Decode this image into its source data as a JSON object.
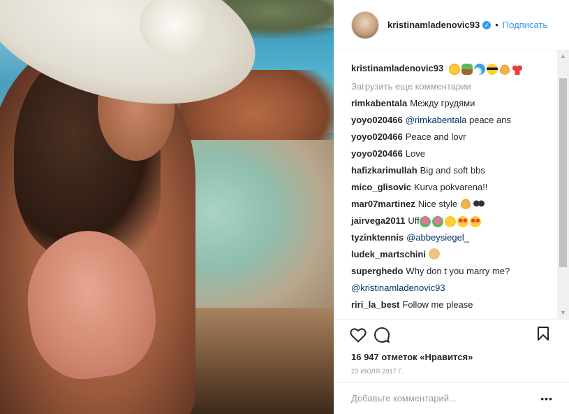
{
  "post": {
    "author": "kristinamladenovic93",
    "follow_label": "Подписать",
    "separator": "•"
  },
  "caption": {
    "user": "kristinamladenovic93",
    "emojis": [
      "sun-emoji",
      "palm-tree-emoji",
      "wave-emoji",
      "sunglasses-face-emoji",
      "sun-hat-emoji",
      "bikini-emoji"
    ]
  },
  "load_more": "Загрузить еще комментарии",
  "comments": [
    {
      "user": "rimkabentala",
      "text": "Между грудями"
    },
    {
      "user": "yoyo020466",
      "mention": "@rimkabentala",
      "text": "peace ans"
    },
    {
      "user": "yoyo020466",
      "text": "Peace and lovr"
    },
    {
      "user": "yoyo020466",
      "text": "Love"
    },
    {
      "user": "hafizkarimullah",
      "text": "Big and soft bbs"
    },
    {
      "user": "mico_glisovic",
      "text": "Kurva pokvarena!!"
    },
    {
      "user": "mar07martinez",
      "text": "Nice style"
    },
    {
      "user": "jairvega2011",
      "text": "Uff"
    },
    {
      "user": "tyzinktennis",
      "mention": "@abbeysiegel_",
      "text": ""
    },
    {
      "user": "ludek_martschini",
      "text": ""
    },
    {
      "user": "superghedo",
      "text": "Why don t you marry me?",
      "mention2": "@kristinamladenovic93"
    },
    {
      "user": "riri_la_best",
      "text": "Follow me please"
    },
    {
      "user": "",
      "text": ""
    }
  ],
  "likes": "16 947 отметок «Нравится»",
  "date": "23 июля 2017 г.",
  "add_comment_placeholder": "Добавьте комментарий...",
  "more_label": "•••",
  "colors": {
    "accent": "#3897f0",
    "text": "#262626",
    "muted": "#999999",
    "mention": "#003569"
  }
}
